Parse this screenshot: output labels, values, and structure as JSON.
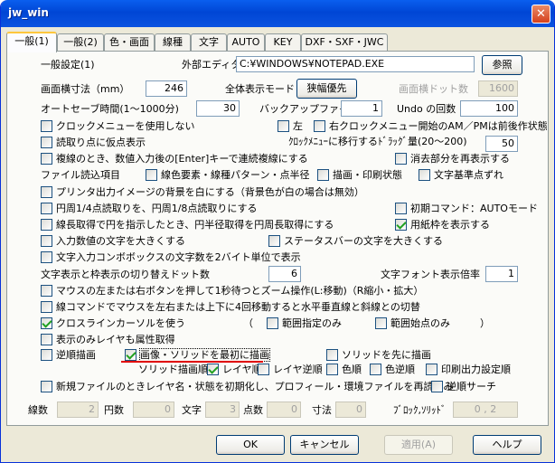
{
  "window": {
    "title": "jw_win",
    "close_glyph": "✕"
  },
  "tabs": [
    {
      "label": "一般(1)",
      "active": true
    },
    {
      "label": "一般(2)"
    },
    {
      "label": "色・画面"
    },
    {
      "label": "線種"
    },
    {
      "label": "文字"
    },
    {
      "label": "AUTO"
    },
    {
      "label": "KEY"
    },
    {
      "label": "DXF・SXF・JWC"
    }
  ],
  "section_title": "一般設定(1)",
  "editor": {
    "label": "外部エディタ",
    "value": "C:¥WINDOWS¥NOTEPAD.EXE",
    "browse": "参照"
  },
  "screen_width": {
    "label": "画面横寸法（mm）",
    "value": "246"
  },
  "full_mode": {
    "label": "全体表示モード",
    "button": "狭幅優先"
  },
  "dot_width": {
    "label": "画面横ドット数",
    "value": "1600"
  },
  "autosave": {
    "label": "オートセーブ時間(1～1000分)",
    "value": "30"
  },
  "backup": {
    "label": "バックアップファイル数",
    "value": "1"
  },
  "undo": {
    "label": "Undo の回数",
    "value": "100"
  },
  "clock_menu": "クロックメニューを使用しない",
  "left": "左",
  "right_clock": "右クロックメニュー開始のAM／PMは前後作状態",
  "temp_point": "読取り点に仮点表示",
  "drag_amount": {
    "label": "ｸﾛｯｸﾒﾆｭｰに移行するﾄﾞﾗｯｸﾞ量(20～200)",
    "value": "50"
  },
  "repeat_enter": "複線のとき、数値入力後の[Enter]キーで連続複線にする",
  "redraw_erase": "消去部分を再表示する",
  "file_read": "ファイル読込項目",
  "color_line": "線色要素・線種パターン・点半径",
  "draw_print": "描画・印刷状態",
  "text_base": "文字基準点ずれ",
  "printer_bg": "プリンタ出力イメージの背景を白にする（背景色が白の場合は無効）",
  "circle_read": "円周1/4点読取りを、円周1/8点読取りにする",
  "init_command": "初期コマンド：AUTOモード",
  "circle_radius": "線長取得で円を指示したとき、円半径取得を円周長取得にする",
  "paper_frame": "用紙枠を表示する",
  "input_large": "入力数値の文字を大きくする",
  "status_large": "ステータスバーの文字を大きくする",
  "combo_2byte": "文字入力コンボボックスの文字数を2バイト単位で表示",
  "text_dots": {
    "label": "文字表示と枠表示の切り替えドット数",
    "value": "6"
  },
  "font_scale": {
    "label": "文字フォント表示倍率",
    "value": "1"
  },
  "mouse_zoom": "マウスの左または右ボタンを押して1秒待つとズーム操作(L:移動)（R縮小・拡大）",
  "line_mouse": "線コマンドでマウスを左右または上下に4回移動すると水平垂直線と斜線との切替",
  "crossline": "クロスラインカーソルを使う",
  "paren_open": "（",
  "range_only": "範囲指定のみ",
  "point_only": "範囲始点のみ",
  "paren_close": "）",
  "layer_attr": "表示のみレイヤも属性取得",
  "reverse_draw": "逆順描画",
  "image_solid_first": "画像・ソリッドを最初に描画",
  "solid_first": "ソリッドを先に描画",
  "solid_order": "ソリッド描画順",
  "layer_order": "レイヤ順",
  "layer_reverse": "レイヤ逆順",
  "color_order": "色順",
  "color_reverse": "色逆順",
  "print_order": "印刷出力設定順",
  "new_file_init": "新規ファイルのときレイヤ名・状態を初期化し、プロフィール・環境ファイルを再読込み",
  "reverse_search": "逆順サーチ",
  "counts": {
    "lines_label": "線数",
    "lines": "2",
    "circles_label": "円数",
    "circles": "0",
    "text_label": "文字",
    "text": "3",
    "points_label": "点数",
    "points": "0",
    "dims_label": "寸法",
    "dims": "0",
    "block_label": "ﾌﾞﾛｯｸ,ｿﾘｯﾄﾞ",
    "block": "0 , 2"
  },
  "footer": {
    "ok": "OK",
    "cancel": "キャンセル",
    "apply": "適用(A)",
    "help": "ヘルプ"
  }
}
